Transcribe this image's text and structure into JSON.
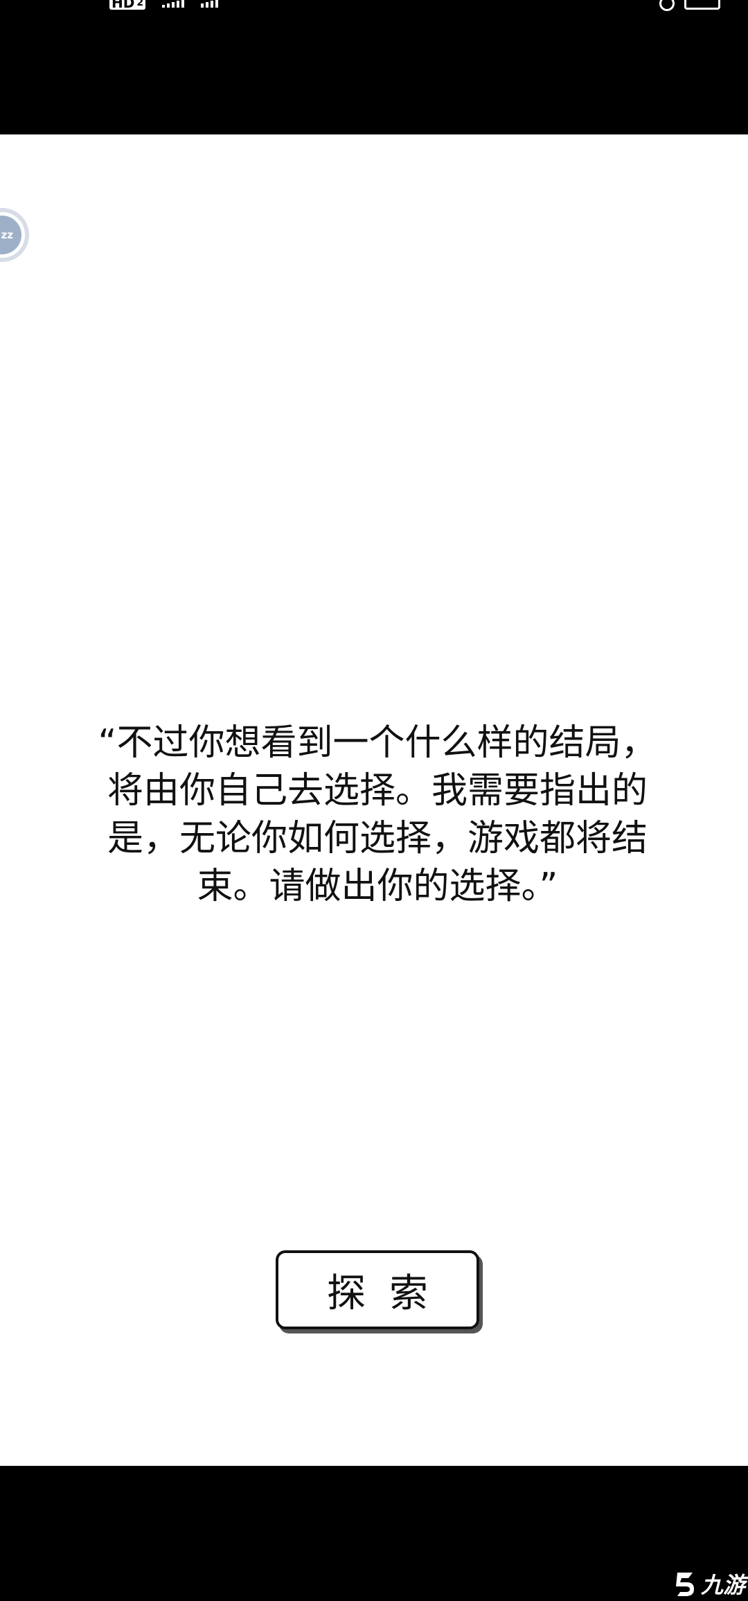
{
  "status_bar": {
    "hd_label": "HD",
    "sim_slot": "2"
  },
  "game": {
    "dialogue": "“不过你想看到一个什么样的结局，将由你自己去选择。我需要指出的是，无论你如何选择，游戏都将结束。请做出你的选择。”",
    "explore_button_label": "探索",
    "sleep_indicator_text": "zz"
  },
  "watermark": {
    "text": "九游"
  },
  "colors": {
    "background": "#ffffff",
    "bars": "#000000",
    "text": "#111111",
    "sleep_bubble": "#9db0c8"
  }
}
